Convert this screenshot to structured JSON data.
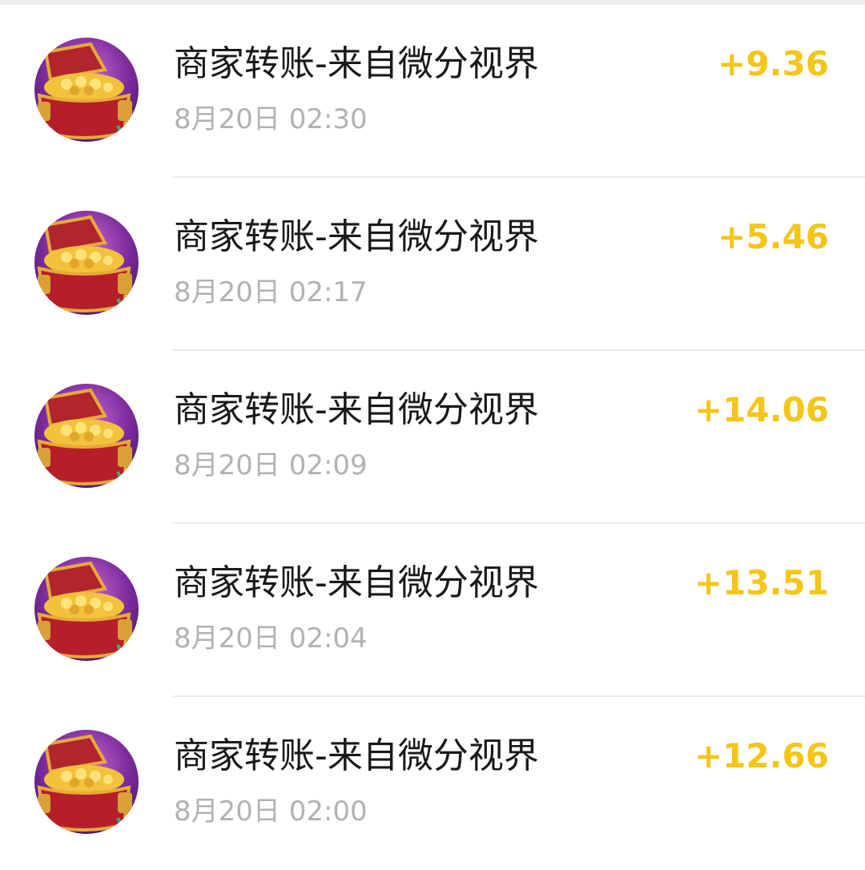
{
  "transactions": [
    {
      "title": "商家转账-来自微分视界",
      "time": "8月20日 02:30",
      "amount": "+9.36",
      "avatar_icon": "treasure-chest-icon"
    },
    {
      "title": "商家转账-来自微分视界",
      "time": "8月20日 02:17",
      "amount": "+5.46",
      "avatar_icon": "treasure-chest-icon"
    },
    {
      "title": "商家转账-来自微分视界",
      "time": "8月20日 02:09",
      "amount": "+14.06",
      "avatar_icon": "treasure-chest-icon"
    },
    {
      "title": "商家转账-来自微分视界",
      "time": "8月20日 02:04",
      "amount": "+13.51",
      "avatar_icon": "treasure-chest-icon"
    },
    {
      "title": "商家转账-来自微分视界",
      "time": "8月20日 02:00",
      "amount": "+12.66",
      "avatar_icon": "treasure-chest-icon"
    }
  ],
  "colors": {
    "amount": "#f5c518",
    "title": "#191919",
    "time": "#b2b2b2",
    "divider": "#ececec"
  }
}
